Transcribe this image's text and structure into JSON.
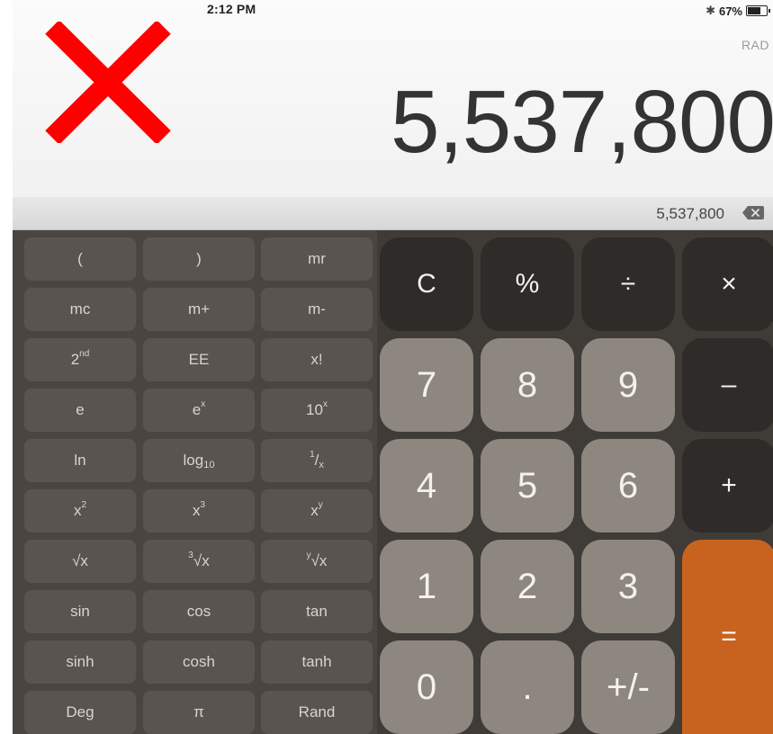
{
  "status_bar": {
    "time": "2:12 PM",
    "battery": "67%"
  },
  "display": {
    "mode": "RAD",
    "value": "5,537,800",
    "history": "5,537,800"
  },
  "sci_keys": {
    "open_paren": "(",
    "close_paren": ")",
    "mr": "mr",
    "mc": "mc",
    "m_plus": "m+",
    "m_minus": "m-",
    "second": "2",
    "second_sup": "nd",
    "ee": "EE",
    "factorial": "x!",
    "e": "e",
    "ex_base": "e",
    "ex_sup": "x",
    "tenx_base": "10",
    "tenx_sup": "x",
    "ln": "ln",
    "log_base": "log",
    "log_sub": "10",
    "recip_sup": "1",
    "recip_main": "/",
    "recip_sub": "x",
    "x2_base": "x",
    "x2_sup": "2",
    "x3_base": "x",
    "x3_sup": "3",
    "xy_base": "x",
    "xy_sup": "y",
    "sqrt": "√x",
    "cbrt_sup": "3",
    "cbrt_main": "√x",
    "yroot_sup": "y",
    "yroot_main": "√x",
    "sin": "sin",
    "cos": "cos",
    "tan": "tan",
    "sinh": "sinh",
    "cosh": "cosh",
    "tanh": "tanh",
    "deg": "Deg",
    "pi": "π",
    "rand": "Rand"
  },
  "basic_keys": {
    "clear": "C",
    "percent": "%",
    "divide": "÷",
    "multiply": "×",
    "seven": "7",
    "eight": "8",
    "nine": "9",
    "minus": "–",
    "four": "4",
    "five": "5",
    "six": "6",
    "plus": "+",
    "one": "1",
    "two": "2",
    "three": "3",
    "equals": "=",
    "zero": "0",
    "decimal": ".",
    "sign": "+/-"
  },
  "colors": {
    "operator_key": "#2e2b28",
    "number_key": "#8e8780",
    "equals_key": "#c8631f",
    "sci_key": "#5a5450",
    "overlay_x": "#ff0000"
  }
}
